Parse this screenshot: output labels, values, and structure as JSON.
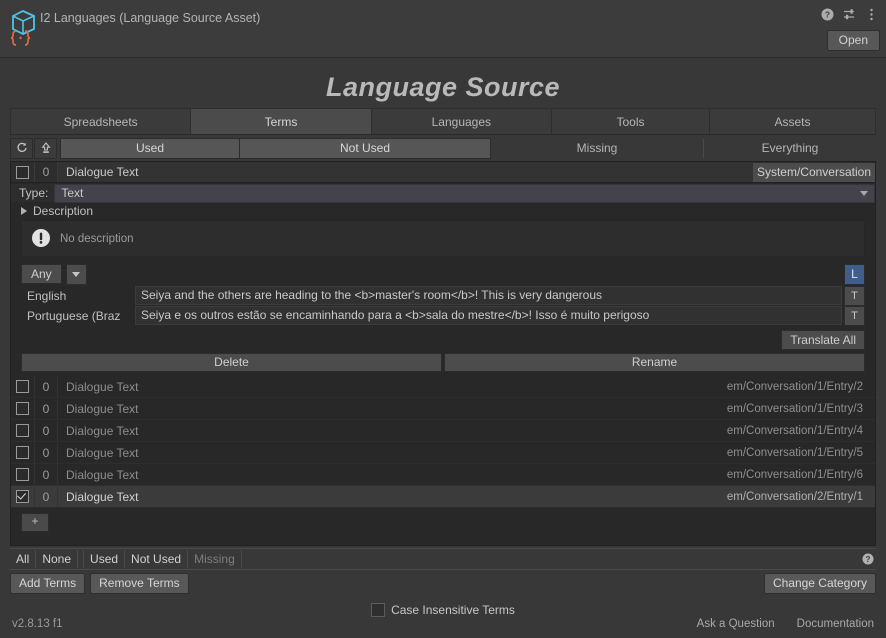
{
  "header": {
    "title": "I2 Languages (Language Source Asset)",
    "icon": "cube-json-icon",
    "help_icon": "help-icon",
    "preset_icon": "preset-sliders-icon",
    "menu_icon": "kebab-menu-icon",
    "open_label": "Open"
  },
  "page_title": "Language Source",
  "tabs": [
    {
      "label": "Spreadsheets",
      "selected": false
    },
    {
      "label": "Terms",
      "selected": true
    },
    {
      "label": "Languages",
      "selected": false
    },
    {
      "label": "Tools",
      "selected": false
    },
    {
      "label": "Assets",
      "selected": false
    }
  ],
  "filter_bar": {
    "refresh_icon": "refresh-icon",
    "export_icon": "export-up-icon",
    "buttons": [
      {
        "label": "Used",
        "active": true
      },
      {
        "label": "Not Used",
        "active": true
      },
      {
        "label": "Missing",
        "active": false
      },
      {
        "label": "Everything",
        "active": false
      }
    ]
  },
  "selected_term": {
    "checked": false,
    "count": "0",
    "name": "Dialogue Text",
    "category": "System/Conversation",
    "type_label": "Type:",
    "type_value": "Text",
    "description_label": "Description",
    "description_value": "No description",
    "warning_icon": "warning-bubble-icon",
    "any_label": "Any",
    "any_caret_icon": "chevron-down-icon",
    "lang_toggle_label": "L",
    "translations": [
      {
        "language": "English",
        "text": "Seiya and the others are heading to the <b>master's room</b>! This is very dangerous",
        "button": "T"
      },
      {
        "language": "Portuguese (Braz",
        "text": "Seiya e os outros estão se encaminhando para a <b>sala do mestre</b>! Isso é muito perigoso",
        "button": "T"
      }
    ],
    "translate_all_label": "Translate All",
    "delete_label": "Delete",
    "rename_label": "Rename"
  },
  "term_rows": [
    {
      "checked": false,
      "count": "0",
      "name": "Dialogue Text",
      "path": "em/Conversation/1/Entry/2",
      "selected": false
    },
    {
      "checked": false,
      "count": "0",
      "name": "Dialogue Text",
      "path": "em/Conversation/1/Entry/3",
      "selected": false
    },
    {
      "checked": false,
      "count": "0",
      "name": "Dialogue Text",
      "path": "em/Conversation/1/Entry/4",
      "selected": false
    },
    {
      "checked": false,
      "count": "0",
      "name": "Dialogue Text",
      "path": "em/Conversation/1/Entry/5",
      "selected": false
    },
    {
      "checked": false,
      "count": "0",
      "name": "Dialogue Text",
      "path": "em/Conversation/1/Entry/6",
      "selected": false
    },
    {
      "checked": true,
      "count": "0",
      "name": "Dialogue Text",
      "path": "em/Conversation/2/Entry/1",
      "selected": true
    }
  ],
  "add_term_label": "+",
  "selection_bar": {
    "all": "All",
    "none": "None",
    "used": "Used",
    "not_used": "Not Used",
    "missing": "Missing",
    "help_icon": "help-circle-icon"
  },
  "actions": {
    "add_terms": "Add Terms",
    "remove_terms": "Remove Terms",
    "change_category": "Change Category"
  },
  "case_insensitive": {
    "checked": false,
    "label": "Case Insensitive Terms"
  },
  "footer": {
    "version": "v2.8.13 f1",
    "ask": "Ask a Question",
    "docs": "Documentation"
  },
  "colors": {
    "background": "#383838",
    "panel": "#282828",
    "accent_blue": "#3f5f8a",
    "button": "#4c4c4c",
    "text": "#c4c4c4"
  }
}
